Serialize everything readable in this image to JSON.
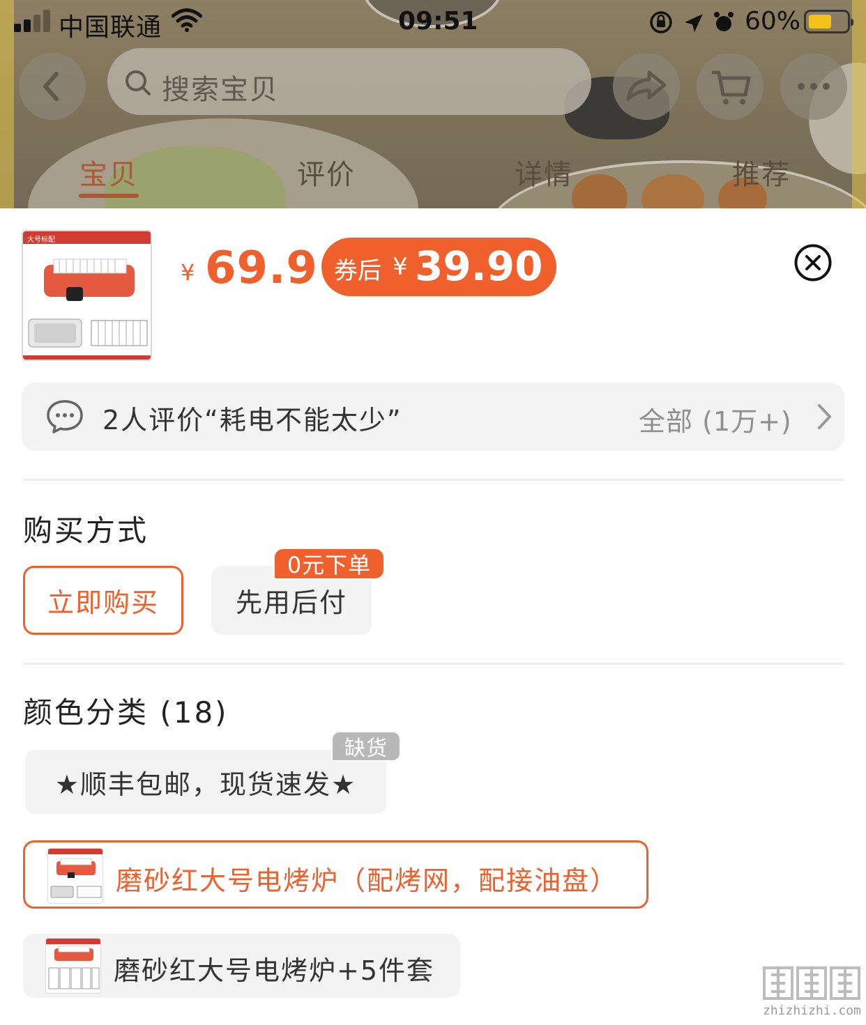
{
  "status_bar": {
    "carrier": "中国联通",
    "time": "09:51",
    "battery": "60%",
    "battery_level": 0.6
  },
  "nav": {
    "search_placeholder": "搜索宝贝",
    "back_icon": "chevron-left-icon",
    "share_icon": "share-icon",
    "cart_icon": "cart-icon",
    "more_icon": "more-icon"
  },
  "tabs": [
    {
      "label": "宝贝",
      "active": true
    },
    {
      "label": "评价",
      "active": false
    },
    {
      "label": "详情",
      "active": false
    },
    {
      "label": "推荐",
      "active": false
    }
  ],
  "product": {
    "thumb_title": "大号标配",
    "currency": "¥",
    "price": "69.9",
    "coupon_label": "券后",
    "coupon_currency": "¥",
    "coupon_price": "39.90"
  },
  "review": {
    "summary": "2人评价“耗电不能太少”",
    "all_label": "全部 (1万+)"
  },
  "purchase": {
    "title": "购买方式",
    "options": [
      {
        "label": "立即购买",
        "selected": true
      },
      {
        "label": "先用后付",
        "selected": false,
        "badge": "0元下单"
      }
    ]
  },
  "color": {
    "title": "颜色分类 (18)",
    "options": [
      {
        "label": "★顺丰包邮，现货速发★",
        "badge": "缺货",
        "selected": false
      },
      {
        "label": "磨砂红大号电烤炉（配烤网，配接油盘）",
        "selected": true
      },
      {
        "label": "磨砂红大号电烤炉+5件套",
        "selected": false
      }
    ]
  },
  "colors": {
    "accent": "#f0602c",
    "muted_bg": "#f3f3f3",
    "dim_overlay": "#7d7259"
  }
}
